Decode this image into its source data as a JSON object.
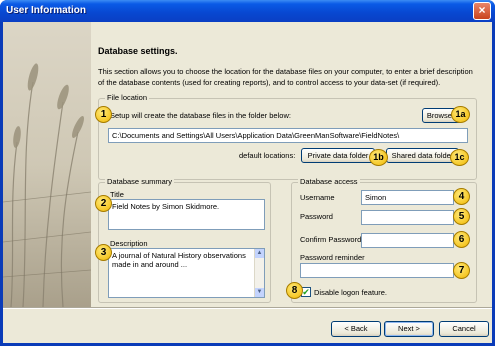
{
  "window": {
    "title": "User Information",
    "close_symbol": "×"
  },
  "page": {
    "heading": "Database settings.",
    "intro": "This section allows you to choose the location for the database files on your computer, to enter a brief description of the database contents (used for creating reports), and to control access to your data-set (if required)."
  },
  "file_location": {
    "legend": "File location",
    "instruction": "Setup will create the database files in the folder below:",
    "browse_label": "Browse...",
    "path": "C:\\Documents and Settings\\All Users\\Application Data\\GreenManSoftware\\FieldNotes\\",
    "default_locations_label": "default locations:",
    "private_label": "Private data folder",
    "shared_label": "Shared data folder"
  },
  "summary": {
    "legend": "Database summary",
    "title_label": "Title",
    "title_value": "Field Notes by Simon Skidmore.",
    "description_label": "Description",
    "description_value": "A journal of Natural History observations made in and around ..."
  },
  "access": {
    "legend": "Database access",
    "username_label": "Username",
    "username_value": "Simon",
    "password_label": "Password",
    "confirm_label": "Confirm Password",
    "reminder_label": "Password reminder",
    "disable_label": "Disable logon feature.",
    "disable_checked": true,
    "check_symbol": "✔"
  },
  "badges": [
    "1",
    "1a",
    "1b",
    "1c",
    "2",
    "3",
    "4",
    "5",
    "6",
    "7",
    "8"
  ],
  "footer": {
    "back_label": "< Back",
    "next_label": "Next >",
    "cancel_label": "Cancel"
  },
  "scroll": {
    "up": "▲",
    "down": "▼"
  }
}
